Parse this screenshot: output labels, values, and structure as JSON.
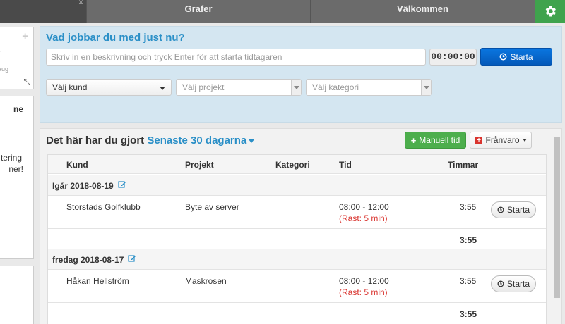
{
  "tabs": {
    "close": "×",
    "grafer": "Grafer",
    "valkommen": "Välkommen"
  },
  "left": {
    "plus": "+",
    "dot": "-",
    "date": "aug",
    "header": "ne",
    "text1": "tering",
    "text2": "ner!"
  },
  "tracker": {
    "title": "Vad jobbar du med just nu?",
    "description_placeholder": "Skriv in en beskrivning och tryck Enter för att starta tidtagaren",
    "timer": "00:00:00",
    "start_label": "Starta",
    "customer_select": "Välj kund",
    "project_placeholder": "Välj projekt",
    "category_placeholder": "Välj kategori"
  },
  "sheet": {
    "title": "Det här har du gjort",
    "period": "Senaste 30 dagarna",
    "manual_label": "Manuell tid",
    "absence_label": "Frånvaro",
    "columns": {
      "kund": "Kund",
      "projekt": "Projekt",
      "kategori": "Kategori",
      "tid": "Tid",
      "timmar": "Timmar"
    },
    "days": [
      {
        "label": "Igår 2018-08-19",
        "entry": {
          "kund": "Storstads Golfklubb",
          "projekt": "Byte av server",
          "tid": "08:00 - 12:00",
          "rast": "(Rast: 5 min)",
          "timmar": "3:55",
          "start": "Starta"
        },
        "total": "3:55"
      },
      {
        "label": "fredag 2018-08-17",
        "entry": {
          "kund": "Håkan Hellström",
          "projekt": "Maskrosen",
          "tid": "08:00 - 12:00",
          "rast": "(Rast: 5 min)",
          "timmar": "3:55",
          "start": "Starta"
        },
        "total": "3:55"
      }
    ]
  },
  "colors": {
    "accent_blue": "#2a8fc7",
    "start_blue": "#0a6fd6",
    "green": "#4cae4c",
    "red": "#d9332e",
    "tracker_bg": "#d4e6f1"
  }
}
